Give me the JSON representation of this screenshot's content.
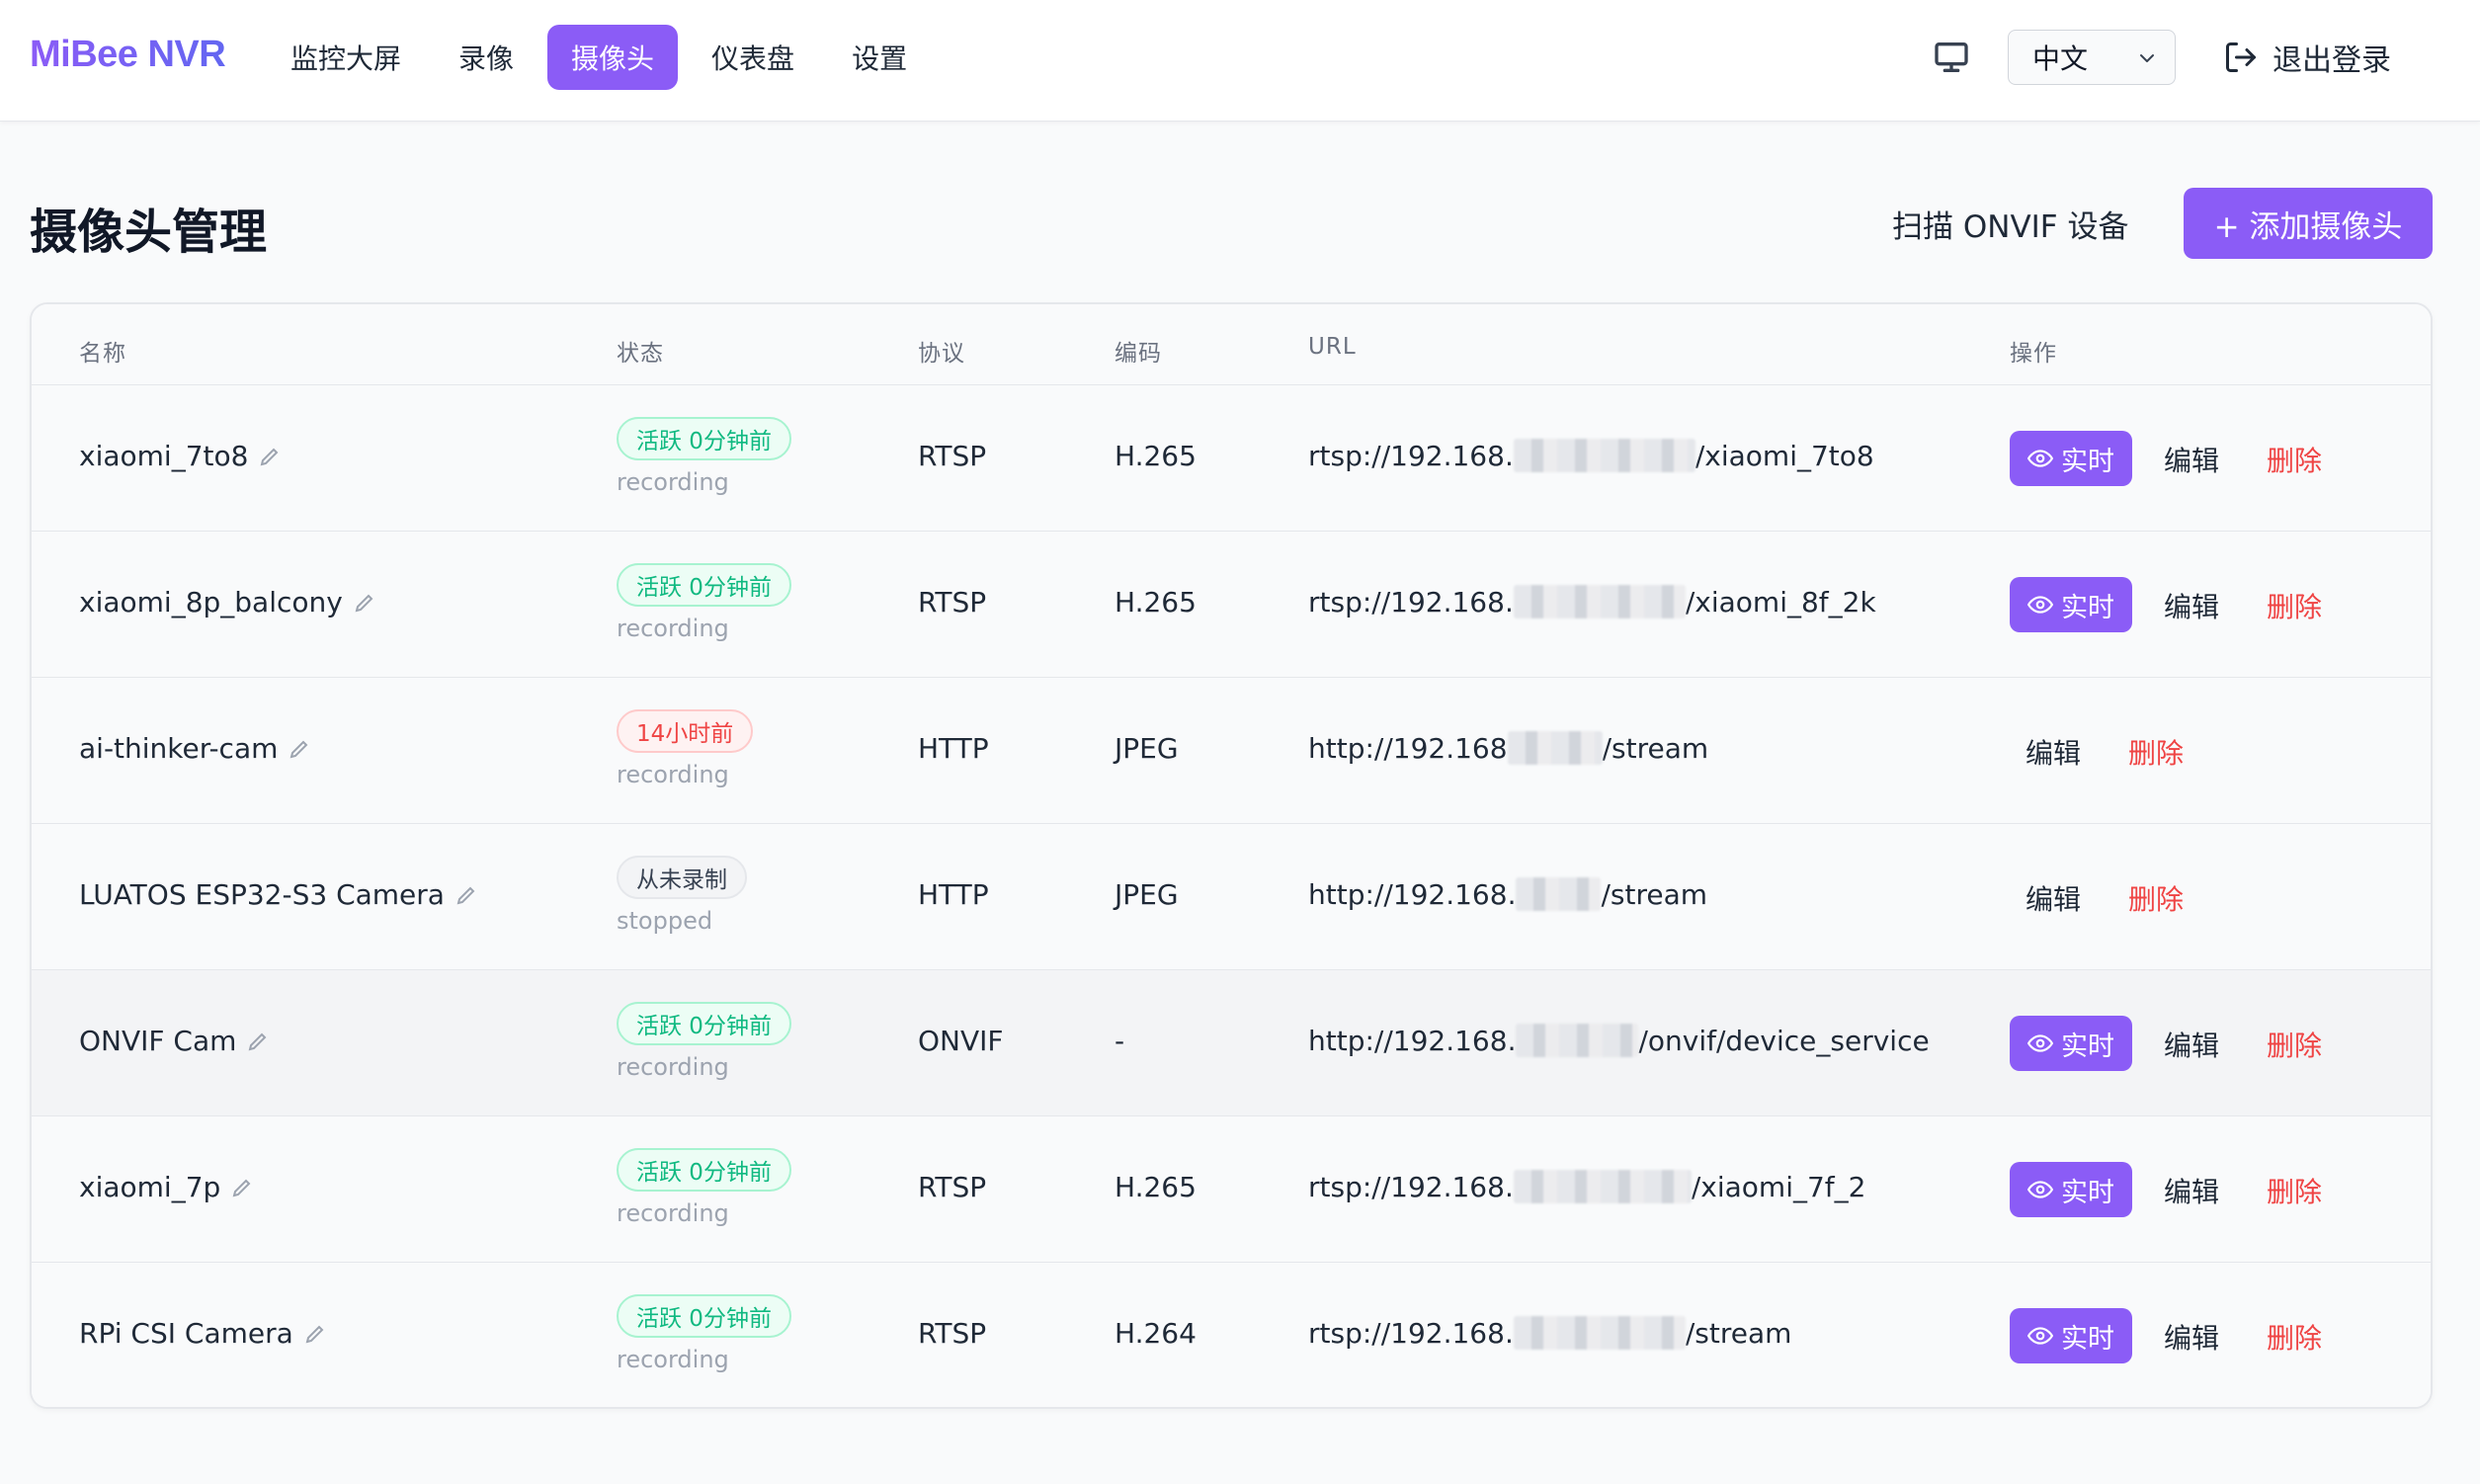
{
  "app": {
    "logo": "MiBee NVR"
  },
  "nav": {
    "items": [
      {
        "label": "监控大屏",
        "active": false
      },
      {
        "label": "录像",
        "active": false
      },
      {
        "label": "摄像头",
        "active": true
      },
      {
        "label": "仪表盘",
        "active": false
      },
      {
        "label": "设置",
        "active": false
      }
    ],
    "language": "中文",
    "logout_label": "退出登录",
    "monitor_icon": "monitor-icon"
  },
  "page": {
    "title": "摄像头管理",
    "scan_label": "扫描 ONVIF 设备",
    "add_label": "+ 添加摄像头"
  },
  "table": {
    "columns": [
      "名称",
      "状态",
      "协议",
      "编码",
      "URL",
      "操作"
    ],
    "actions": {
      "live": "实时",
      "edit": "编辑",
      "delete": "删除"
    },
    "rows": [
      {
        "name": "xiaomi_7to8",
        "badge": "活跃 0分钟前",
        "badge_color": "green",
        "state": "recording",
        "protocol": "RTSP",
        "codec": "H.265",
        "url_prefix": "rtsp://192.168.",
        "url_suffix": "/xiaomi_7to8",
        "live": true
      },
      {
        "name": "xiaomi_8p_balcony",
        "badge": "活跃 0分钟前",
        "badge_color": "green",
        "state": "recording",
        "protocol": "RTSP",
        "codec": "H.265",
        "url_prefix": "rtsp://192.168.",
        "url_suffix": "/xiaomi_8f_2k",
        "live": true
      },
      {
        "name": "ai-thinker-cam",
        "badge": "14小时前",
        "badge_color": "red",
        "state": "recording",
        "protocol": "HTTP",
        "codec": "JPEG",
        "url_prefix": "http://192.168",
        "url_suffix": "/stream",
        "live": false
      },
      {
        "name": "LUATOS ESP32-S3 Camera",
        "badge": "从未录制",
        "badge_color": "gray",
        "state": "stopped",
        "protocol": "HTTP",
        "codec": "JPEG",
        "url_prefix": "http://192.168.",
        "url_suffix": "/stream",
        "live": false
      },
      {
        "name": "ONVIF Cam",
        "badge": "活跃 0分钟前",
        "badge_color": "green",
        "state": "recording",
        "protocol": "ONVIF",
        "codec": "-",
        "url_prefix": "http://192.168.",
        "url_suffix": "/onvif/device_service",
        "live": true
      },
      {
        "name": "xiaomi_7p",
        "badge": "活跃 0分钟前",
        "badge_color": "green",
        "state": "recording",
        "protocol": "RTSP",
        "codec": "H.265",
        "url_prefix": "rtsp://192.168.",
        "url_suffix": "/xiaomi_7f_2",
        "live": true
      },
      {
        "name": "RPi CSI Camera",
        "badge": "活跃 0分钟前",
        "badge_color": "green",
        "state": "recording",
        "protocol": "RTSP",
        "codec": "H.264",
        "url_prefix": "rtsp://192.168.",
        "url_suffix": "/stream",
        "live": true
      }
    ]
  },
  "colors": {
    "accent": "#8b5cf6",
    "danger": "#ef4444",
    "success": "#10b981"
  }
}
